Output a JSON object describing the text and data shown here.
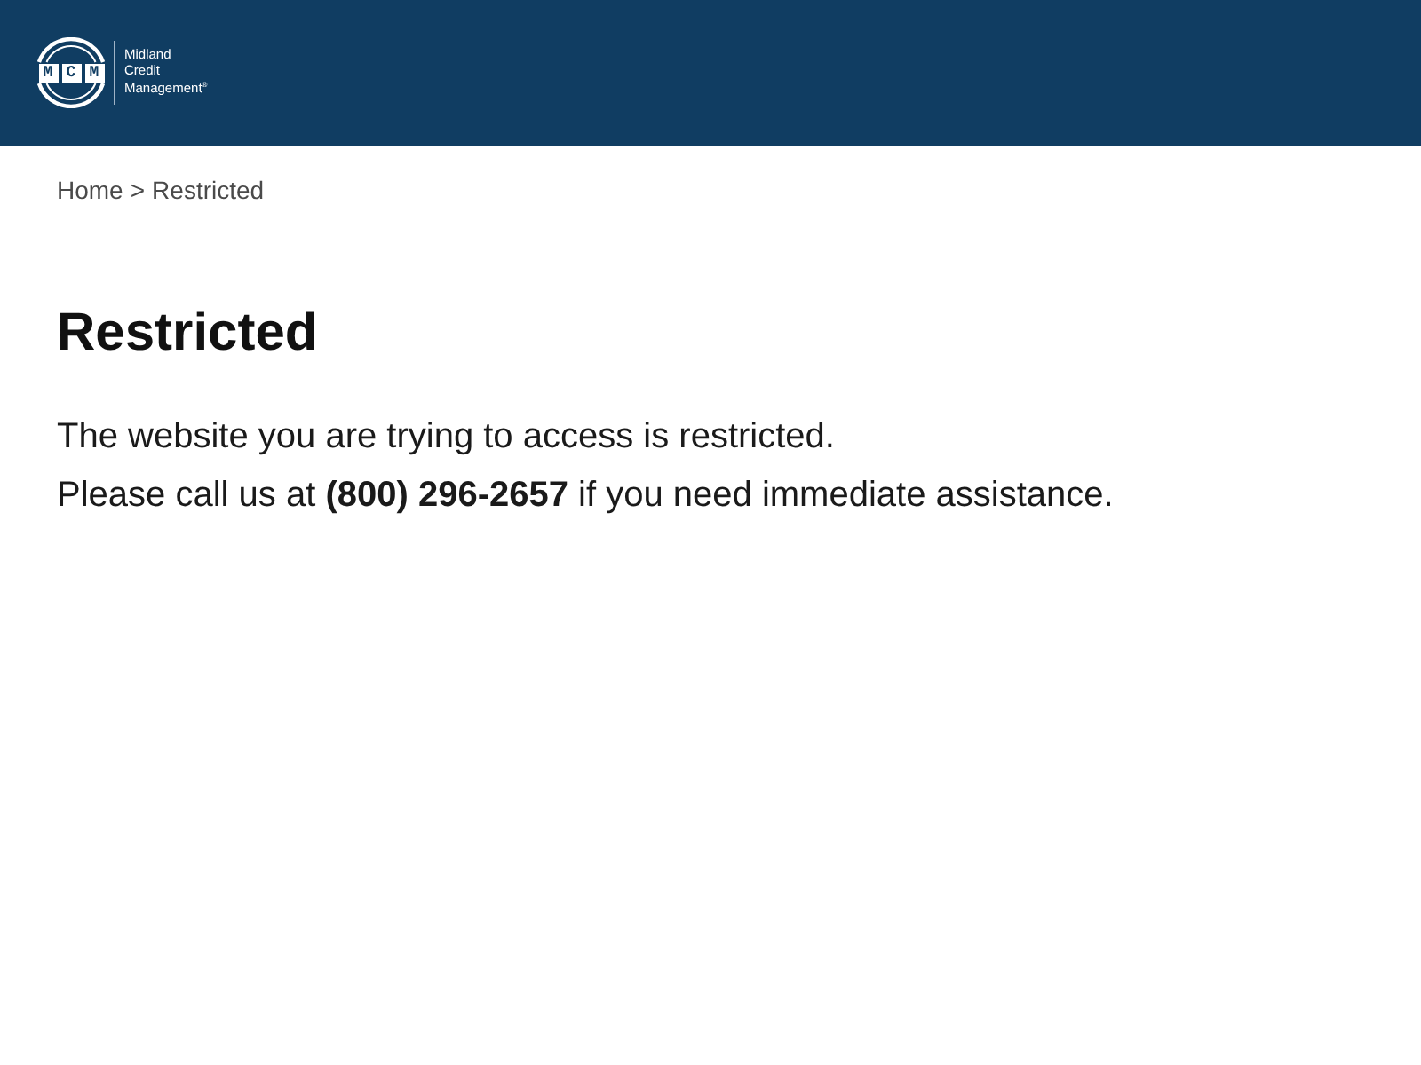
{
  "header": {
    "logo": {
      "mark": "MCM",
      "wordmark": [
        "Midland",
        "Credit",
        "Management$^{®}$"
      ]
    }
  },
  "breadcrumb": {
    "separator": ">",
    "items": [
      "Home",
      "Restricted"
    ]
  },
  "heading": "Restricted",
  "message": [
    "The website you are trying to access is restricted.",
    "Please call us at **(800) 296-2657** if you need immediate assistance."
  ]
}
